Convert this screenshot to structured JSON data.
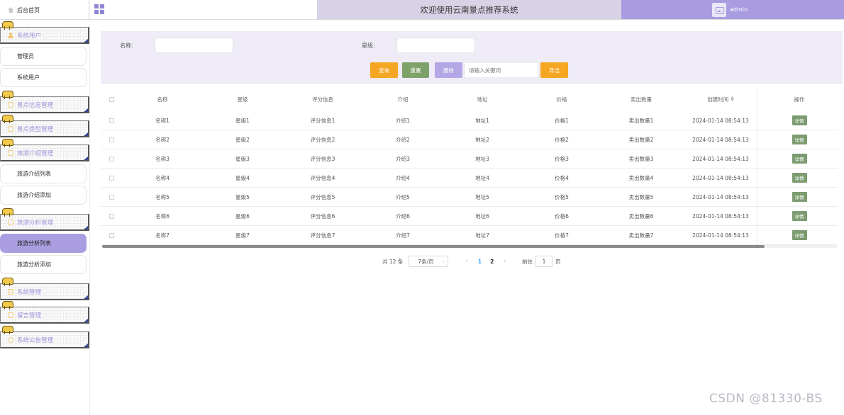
{
  "header": {
    "home_label": "后台首页",
    "welcome": "欢迎使用云南景点推荐系统",
    "username": "admin"
  },
  "sidebar": {
    "groups": [
      {
        "label": "系统用户",
        "icon": "user-icon"
      },
      {
        "label": "景点信息管理",
        "icon": "doc-icon"
      },
      {
        "label": "景点类型管理",
        "icon": "doc-icon"
      },
      {
        "label": "旅游介绍管理",
        "icon": "doc-icon"
      },
      {
        "label": "旅游分析管理",
        "icon": "doc-icon"
      },
      {
        "label": "系统管理",
        "icon": "grid-icon"
      },
      {
        "label": "留言管理",
        "icon": "doc-icon"
      },
      {
        "label": "系统公告管理",
        "icon": "info-icon"
      }
    ],
    "sub_items": {
      "admin": "管理员",
      "sys_user": "系统用户",
      "intro_list": "旅游介绍列表",
      "intro_add": "旅游介绍添加",
      "analysis_list": "旅游分析列表",
      "analysis_add": "旅游分析添加"
    },
    "active_item": "旅游分析列表"
  },
  "search": {
    "name_label": "名称:",
    "name_value": "",
    "star_label": "星级:",
    "star_value": "",
    "query_label": "查询",
    "reset_label": "重置",
    "delete_label": "删除",
    "keyword_placeholder": "请输入关键词",
    "export_label": "导出"
  },
  "colors": {
    "accent": "#a89be0",
    "welcome_bg": "#d9d2e6",
    "panel_bg": "#efecf8",
    "query": "#f5a623",
    "reset": "#7ea36a",
    "delete": "#b4a7e6",
    "detail": "#7c9c70"
  },
  "table": {
    "columns": [
      "名称",
      "星级",
      "评分信息",
      "介绍",
      "地址",
      "价格",
      "卖出数量",
      "创建时间",
      "操作"
    ],
    "rows": [
      [
        "名称1",
        "星级1",
        "评分信息1",
        "介绍1",
        "地址1",
        "价格1",
        "卖出数量1",
        "2024-01-14 08:54:13"
      ],
      [
        "名称2",
        "星级2",
        "评分信息2",
        "介绍2",
        "地址2",
        "价格2",
        "卖出数量2",
        "2024-01-14 08:54:13"
      ],
      [
        "名称3",
        "星级3",
        "评分信息3",
        "介绍3",
        "地址3",
        "价格3",
        "卖出数量3",
        "2024-01-14 08:54:13"
      ],
      [
        "名称4",
        "星级4",
        "评分信息4",
        "介绍4",
        "地址4",
        "价格4",
        "卖出数量4",
        "2024-01-14 08:54:13"
      ],
      [
        "名称5",
        "星级5",
        "评分信息5",
        "介绍5",
        "地址5",
        "价格5",
        "卖出数量5",
        "2024-01-14 08:54:13"
      ],
      [
        "名称6",
        "星级6",
        "评分信息6",
        "介绍6",
        "地址6",
        "价格6",
        "卖出数量6",
        "2024-01-14 08:54:13"
      ],
      [
        "名称7",
        "星级7",
        "评分信息7",
        "介绍7",
        "地址7",
        "价格7",
        "卖出数量7",
        "2024-01-14 08:54:13"
      ]
    ],
    "action_label": "详情"
  },
  "pagination": {
    "total_text": "共 12 条",
    "page_size": "7条/页",
    "pages": [
      "1",
      "2"
    ],
    "current_page": "1",
    "goto_label": "前往",
    "goto_value": "1",
    "page_suffix": "页"
  },
  "watermark": "CSDN @81330-BS"
}
